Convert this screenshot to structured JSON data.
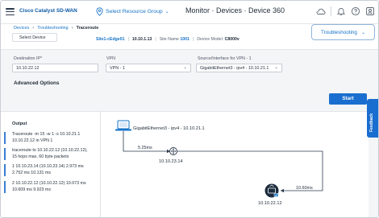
{
  "header": {
    "brand": "Cisco Catalyst SD-WAN",
    "group_select": "Select Resource Group",
    "title": "Monitor · Devices · Device 360"
  },
  "breadcrumb": {
    "items": [
      "Devices",
      "Troubleshooting"
    ],
    "current": "Traceroute"
  },
  "device_select": {
    "label": "Select Device"
  },
  "device_info": {
    "hostname": "Site1-cEdge01",
    "ip": "10.10.1.13",
    "site_label": "Site Name",
    "site_value": "1001",
    "model_label": "Device Model:",
    "model_value": "C8000v"
  },
  "troubleshooting_button": "Troubleshooting",
  "form": {
    "destination_label": "Destination IP*",
    "destination_value": "10.10.22.12",
    "vpn_label": "VPN",
    "vpn_value": "VPN - 1",
    "source_label": "Source/Interface for VPN - 1",
    "source_value": "GigabitEthernet3 - ipv4 - 10.10.21.1"
  },
  "advanced_options": "Advanced Options",
  "start_button": "Start",
  "feedback": "Feedback",
  "output": {
    "title": "Output",
    "blocks": [
      [
        "Traceroute -m 15 -w 1 -s 10.10.21.1",
        "10.10.22.12 in VPN 1"
      ],
      [
        "traceroute to 10.10.22.12 (10.10.22.12),",
        "15 hops max, 60 byte packets"
      ],
      [
        "1 10.10.23.14 (10.10.23.14) 2.973 ms",
        "2.752 ms 10.131 ms"
      ],
      [
        "2 10.10.22.12 (10.10.22.12) 10.073 ms",
        "10.609 ms 9.923 ms"
      ]
    ]
  },
  "topology": {
    "source_label": "GigabitEthernet3 - ipv4 - 10.10.21.1",
    "hop1_latency": "5.25ms",
    "hop1_ip": "10.10.23.14",
    "hop2_latency": "10.60ms",
    "hop2_ip": "10.10.22.12"
  }
}
